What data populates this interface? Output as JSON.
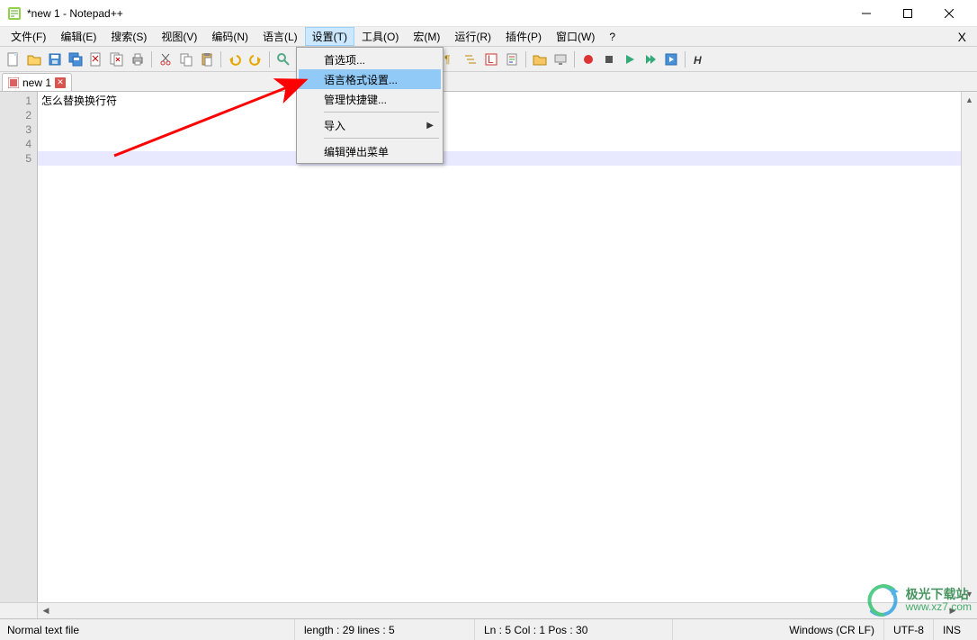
{
  "window": {
    "title": "*new 1 - Notepad++"
  },
  "menubar": {
    "items": [
      "文件(F)",
      "编辑(E)",
      "搜索(S)",
      "视图(V)",
      "编码(N)",
      "语言(L)",
      "设置(T)",
      "工具(O)",
      "宏(M)",
      "运行(R)",
      "插件(P)",
      "窗口(W)",
      "?"
    ],
    "active_index": 6,
    "close_x": "X"
  },
  "toolbar": {
    "icons": [
      "new-file-icon",
      "open-file-icon",
      "save-icon",
      "save-all-icon",
      "close-icon",
      "close-all-icon",
      "print-icon",
      "sep",
      "cut-icon",
      "copy-icon",
      "paste-icon",
      "sep",
      "undo-icon",
      "redo-icon",
      "sep",
      "find-icon",
      "replace-icon",
      "sep",
      "zoom-in-icon",
      "zoom-out-icon",
      "sep",
      "sync-v-icon",
      "sync-h-icon",
      "sep",
      "wrap-icon",
      "all-chars-icon",
      "indent-guide-icon",
      "lang-icon",
      "doc-map-icon",
      "sep",
      "folder-icon",
      "monitor-icon",
      "sep",
      "record-macro-icon",
      "stop-macro-icon",
      "play-macro-icon",
      "play-multi-icon",
      "save-macro-icon",
      "sep",
      "header-icon"
    ]
  },
  "tabs": {
    "items": [
      {
        "label": "new 1",
        "dirty": true
      }
    ]
  },
  "editor": {
    "lines": [
      "怎么替换换行符",
      "",
      "",
      "",
      ""
    ],
    "current_line_index": 4
  },
  "gutter": {
    "numbers": [
      "1",
      "2",
      "3",
      "4",
      "5"
    ]
  },
  "dropdown": {
    "items": [
      {
        "label": "首选项...",
        "type": "item"
      },
      {
        "label": "语言格式设置...",
        "type": "item",
        "highlighted": true
      },
      {
        "label": "管理快捷键...",
        "type": "item"
      },
      {
        "type": "sep"
      },
      {
        "label": "导入",
        "type": "submenu"
      },
      {
        "type": "sep"
      },
      {
        "label": "编辑弹出菜单",
        "type": "item"
      }
    ]
  },
  "statusbar": {
    "file_type": "Normal text file",
    "length_label": "length : 29    lines : 5",
    "position_label": "Ln : 5    Col : 1    Pos : 30",
    "eol": "Windows (CR LF)",
    "encoding": "UTF-8",
    "mode": "INS"
  },
  "watermark": {
    "line1": "极光下载站",
    "line2": "www.xz7.com"
  },
  "colors": {
    "highlight": "#91c9f7",
    "currentline": "#e8e8ff"
  }
}
